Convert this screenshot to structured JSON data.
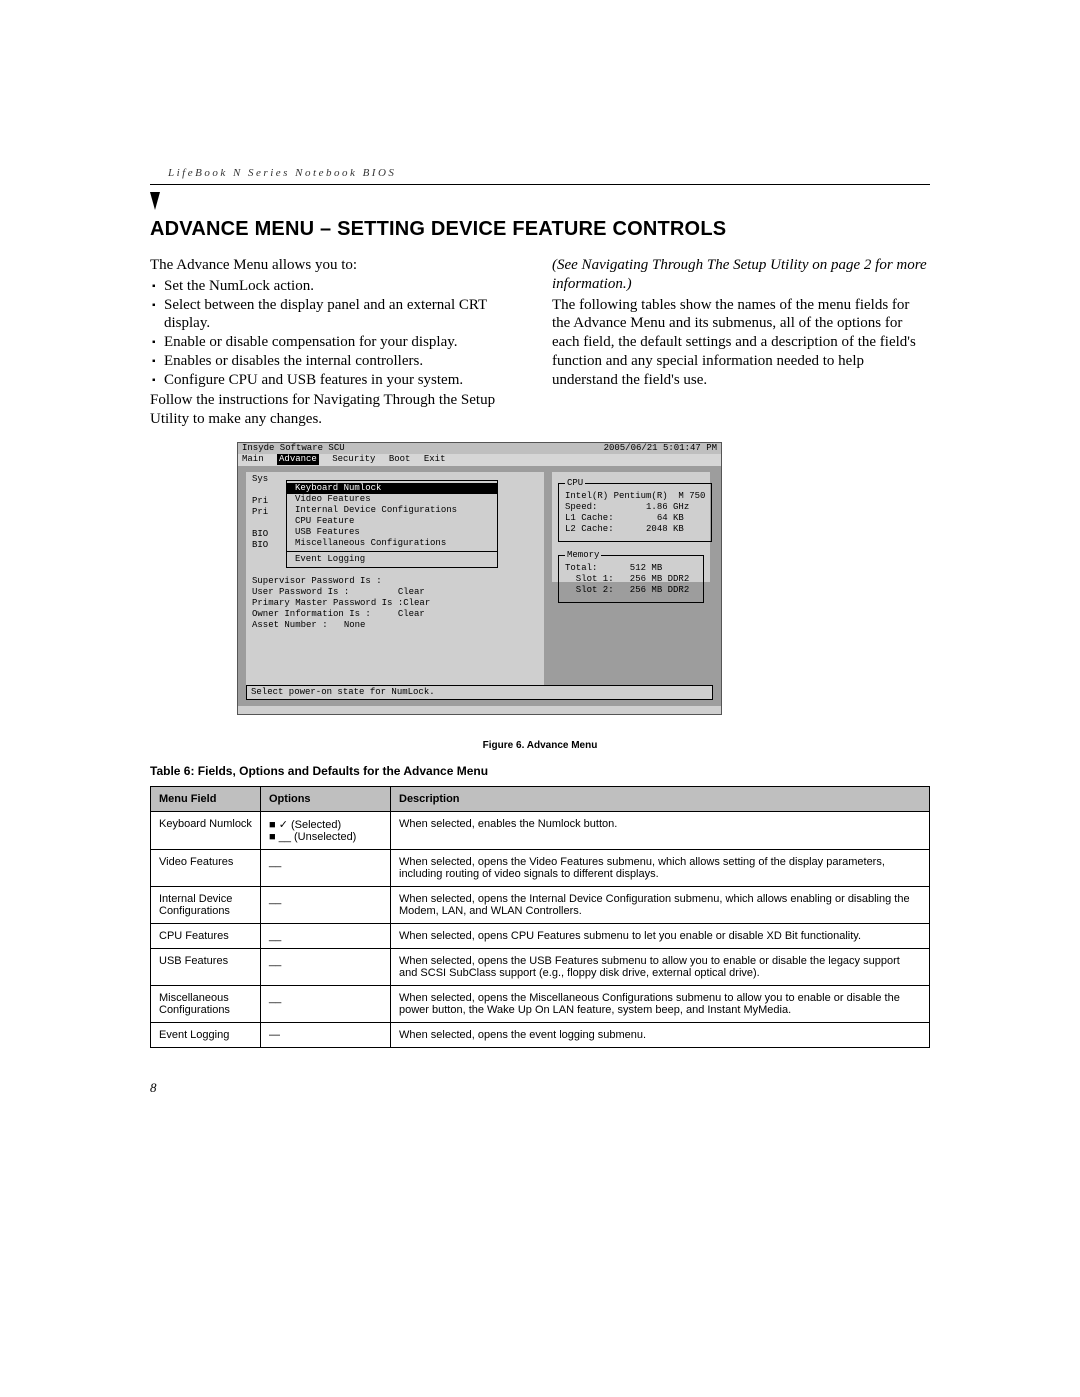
{
  "header": {
    "running_head": "LifeBook N Series Notebook BIOS"
  },
  "title": "ADVANCE MENU – SETTING DEVICE FEATURE CONTROLS",
  "left_col": {
    "intro": "The Advance Menu allows you to:",
    "bullets": [
      "Set the NumLock action.",
      "Select between the display panel and an external CRT display.",
      "Enable or disable compensation for your display.",
      "Enables or disables the internal controllers.",
      "Configure CPU and USB features in your system."
    ],
    "follow": "Follow the instructions for Navigating Through the Setup Utility to make any changes."
  },
  "right_col": {
    "cross_ref": "(See Navigating Through The Setup Utility on page 2 for more information.)",
    "para": "The following tables show the names of the menu fields for the Advance Menu and its submenus, all of the options for each field, the default settings and a description of the field's function and any special information needed to help understand the field's use."
  },
  "bios": {
    "title_left": "Insyde Software SCU",
    "title_right": "2005/06/21  5:01:47 PM",
    "menus": [
      "Main",
      "Advance",
      "Security",
      "Boot",
      "Exit"
    ],
    "menu_selected_index": 1,
    "dropdown": {
      "items_top": [
        "Keyboard Numlock",
        "Video Features",
        "Internal Device Configurations",
        "CPU Feature",
        "USB Features",
        "Miscellaneous Configurations"
      ],
      "selected_index": 0,
      "items_bottom": [
        "Event Logging"
      ]
    },
    "left_visible_labels": [
      "Sys",
      "Pri",
      "Pri",
      "BIO",
      "BIO"
    ],
    "under_list_lines": [
      "Supervisor Password Is :",
      "User Password Is :         Clear",
      "Primary Master Password Is :Clear",
      "",
      "Owner Information Is :     Clear",
      "Asset Number :   None"
    ],
    "cpu_box": {
      "legend": "CPU",
      "lines": [
        "Intel(R) Pentium(R)  M 750",
        "Speed:         1.86 GHz",
        "L1 Cache:        64 KB",
        "L2 Cache:      2048 KB"
      ]
    },
    "memory_box": {
      "legend": "Memory",
      "lines": [
        "Total:      512 MB",
        "  Slot 1:   256 MB DDR2",
        "  Slot 2:   256 MB DDR2"
      ]
    },
    "status_line": "Select power-on state for NumLock."
  },
  "figure_caption": "Figure 6.  Advance Menu",
  "table_title": "Table 6: Fields, Options and Defaults for the Advance Menu",
  "table": {
    "headers": [
      "Menu Field",
      "Options",
      "Description"
    ],
    "rows": [
      {
        "field": "Keyboard Numlock",
        "options_html": "■  ✓  (Selected)\n■  __  (Unselected)",
        "desc": "When selected, enables the Numlock button."
      },
      {
        "field": "Video Features",
        "options_html": "__",
        "desc": "When selected, opens the Video Features submenu, which allows setting of the display parameters, including routing of video signals to different displays."
      },
      {
        "field": "Internal Device Configurations",
        "options_html": "__",
        "desc": "When selected, opens the Internal Device Configuration submenu, which allows enabling or disabling the Modem, LAN, and WLAN Controllers."
      },
      {
        "field": "CPU Features",
        "options_html": "__",
        "desc": "When selected, opens CPU Features submenu to let you enable or disable XD Bit functionality."
      },
      {
        "field": "USB Features",
        "options_html": "__",
        "desc": "When selected, opens the USB Features submenu to allow you to enable or disable the legacy support and SCSI SubClass support (e.g., floppy disk drive, external optical drive)."
      },
      {
        "field": "Miscellaneous Configurations",
        "options_html": "__",
        "desc": "When selected, opens the Miscellaneous Configurations submenu to allow you to enable or disable the power button, the Wake Up On LAN feature, system beep, and Instant MyMedia."
      },
      {
        "field": "Event Logging",
        "options_html": "—",
        "desc": "When selected, opens the event logging submenu."
      }
    ]
  },
  "page_number": "8"
}
